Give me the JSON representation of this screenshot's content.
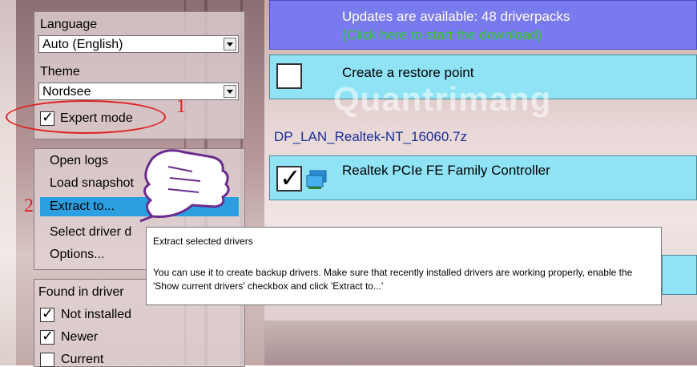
{
  "left_panel": {
    "language": {
      "label": "Language",
      "value": "Auto (English)"
    },
    "theme": {
      "label": "Theme",
      "value": "Nordsee"
    },
    "expert_mode": {
      "label": "Expert mode",
      "checked": true
    },
    "menu": {
      "items": [
        {
          "label": "Open logs"
        },
        {
          "label": "Load snapshot"
        },
        {
          "label": "Extract to..."
        },
        {
          "label": "Select driver d"
        },
        {
          "label": "Options..."
        }
      ],
      "selected_index": 2
    },
    "filters": {
      "title": "Found in driver",
      "items": [
        {
          "label": "Not installed",
          "checked": true
        },
        {
          "label": "Newer",
          "checked": true
        },
        {
          "label": "Current",
          "checked": false
        }
      ]
    }
  },
  "annotations": {
    "step1": "1",
    "step2": "2"
  },
  "main": {
    "update_bar": {
      "title": "Updates are available: 48 driverpacks",
      "subtitle": "(Click here to start the download)"
    },
    "restore_point": {
      "label": "Create a restore point",
      "checked": false
    },
    "pack_name": "DP_LAN_Realtek-NT_16060.7z",
    "driver": {
      "label": "Realtek PCIe FE Family Controller",
      "checked": true
    },
    "watermark": "Quantrimang"
  },
  "tooltip": {
    "title": "Extract selected drivers",
    "body": "You can use it to create backup drivers. Make sure that recently installed drivers are working properly, enable the 'Show current drivers' checkbox and click 'Extract to...'"
  },
  "colors": {
    "update_bar": "#7a7aef",
    "row_cyan": "#8fe3f4",
    "selected_menu": "#2c9fe0",
    "annotation_red": "#e02020"
  }
}
